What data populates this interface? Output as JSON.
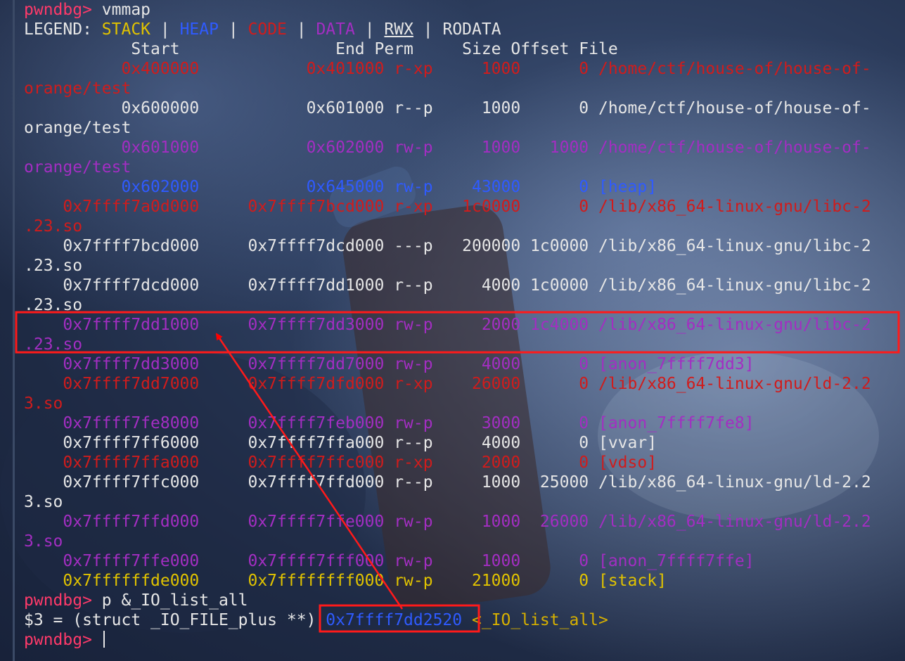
{
  "colors": {
    "prompt": "#ff3a6a",
    "stack": "#e1c300",
    "heap": "#2f5bff",
    "code": "#d01c1c",
    "data": "#a32ec2",
    "text": "#e6e6e6",
    "annotation": "#ff0000"
  },
  "prompt": "pwndbg> ",
  "commands": {
    "vmmap": "vmmap",
    "print": "p &_IO_list_all"
  },
  "legend": {
    "label": "LEGEND: ",
    "sep": " | ",
    "stack": "STACK",
    "heap": "HEAP",
    "code": "CODE",
    "data": "DATA",
    "rwx": "RWX",
    "rodata": "RODATA"
  },
  "header": "           Start                End Perm     Size Offset File",
  "vmmap_lines": [
    {
      "kind": "code",
      "text": "          0x400000           0x401000 r-xp     1000      0 /home/ctf/house-of/house-of-"
    },
    {
      "kind": "code",
      "text": "orange/test"
    },
    {
      "kind": "white",
      "text": "          0x600000           0x601000 r--p     1000      0 /home/ctf/house-of/house-of-"
    },
    {
      "kind": "white",
      "text": "orange/test"
    },
    {
      "kind": "data",
      "text": "          0x601000           0x602000 rw-p     1000   1000 /home/ctf/house-of/house-of-"
    },
    {
      "kind": "data",
      "text": "orange/test"
    },
    {
      "kind": "heap",
      "text": "          0x602000           0x645000 rw-p    43000      0 [heap]"
    },
    {
      "kind": "code",
      "text": "    0x7ffff7a0d000     0x7ffff7bcd000 r-xp   1c0000      0 /lib/x86_64-linux-gnu/libc-2"
    },
    {
      "kind": "code",
      "text": ".23.so"
    },
    {
      "kind": "white",
      "text": "    0x7ffff7bcd000     0x7ffff7dcd000 ---p   200000 1c0000 /lib/x86_64-linux-gnu/libc-2"
    },
    {
      "kind": "white",
      "text": ".23.so"
    },
    {
      "kind": "white",
      "text": "    0x7ffff7dcd000     0x7ffff7dd1000 r--p     4000 1c0000 /lib/x86_64-linux-gnu/libc-2"
    },
    {
      "kind": "white",
      "text": ".23.so"
    },
    {
      "kind": "data",
      "text": "    0x7ffff7dd1000     0x7ffff7dd3000 rw-p     2000 1c4000 /lib/x86_64-linux-gnu/libc-2"
    },
    {
      "kind": "data",
      "text": ".23.so"
    },
    {
      "kind": "data",
      "text": "    0x7ffff7dd3000     0x7ffff7dd7000 rw-p     4000      0 [anon_7ffff7dd3]"
    },
    {
      "kind": "code",
      "text": "    0x7ffff7dd7000     0x7ffff7dfd000 r-xp    26000      0 /lib/x86_64-linux-gnu/ld-2.2"
    },
    {
      "kind": "code",
      "text": "3.so"
    },
    {
      "kind": "data",
      "text": "    0x7ffff7fe8000     0x7ffff7feb000 rw-p     3000      0 [anon_7ffff7fe8]"
    },
    {
      "kind": "white",
      "text": "    0x7ffff7ff6000     0x7ffff7ffa000 r--p     4000      0 [vvar]"
    },
    {
      "kind": "code",
      "text": "    0x7ffff7ffa000     0x7ffff7ffc000 r-xp     2000      0 [vdso]"
    },
    {
      "kind": "white",
      "text": "    0x7ffff7ffc000     0x7ffff7ffd000 r--p     1000  25000 /lib/x86_64-linux-gnu/ld-2.2"
    },
    {
      "kind": "white",
      "text": "3.so"
    },
    {
      "kind": "data",
      "text": "    0x7ffff7ffd000     0x7ffff7ffe000 rw-p     1000  26000 /lib/x86_64-linux-gnu/ld-2.2"
    },
    {
      "kind": "data",
      "text": "3.so"
    },
    {
      "kind": "data",
      "text": "    0x7ffff7ffe000     0x7ffff7fff000 rw-p     1000      0 [anon_7ffff7ffe]"
    },
    {
      "kind": "stack",
      "text": "    0x7ffffffde000     0x7ffffffff000 rw-p    21000      0 [stack]"
    }
  ],
  "print_result": {
    "prefix": "$3 = (struct _IO_FILE_plus **) ",
    "address": "0x7ffff7dd2520",
    "space": " ",
    "symbol": "<_IO_list_all>"
  }
}
